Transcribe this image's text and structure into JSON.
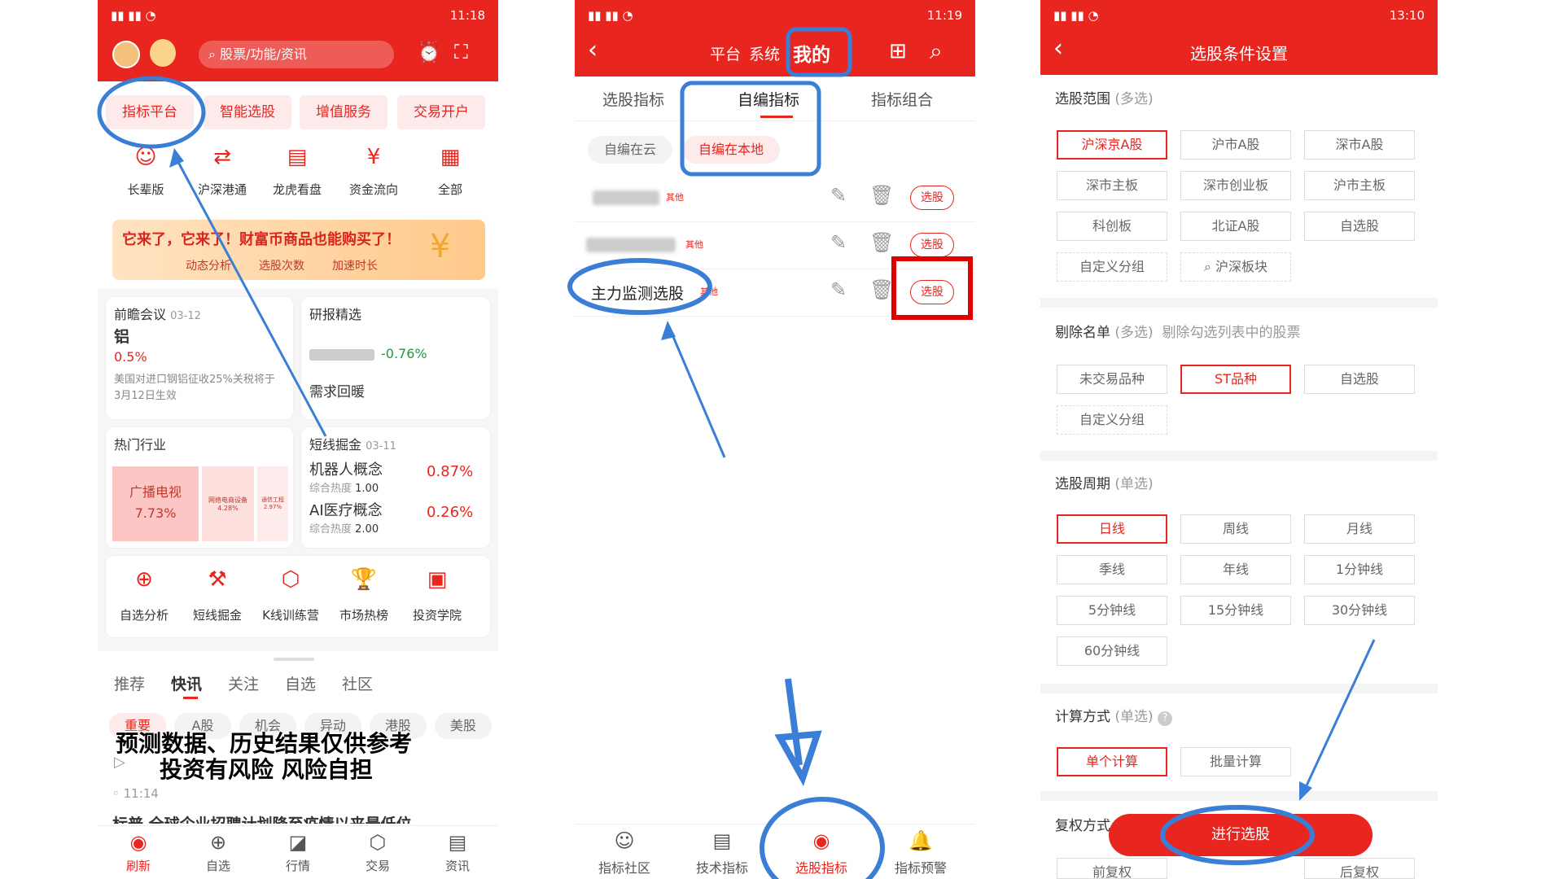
{
  "colors": {
    "brand_red": "#e8261f",
    "annotation_blue": "#3a7fd5",
    "highlight_red": "#e00000",
    "up": "#e8261f",
    "down": "#1a9c3c"
  },
  "p1": {
    "status_time": "11:18",
    "search_placeholder": "股票/功能/资讯",
    "tabs": [
      "指标平台",
      "智能选股",
      "增值服务",
      "交易开户"
    ],
    "icons": [
      {
        "label": "长辈版",
        "icon": "elder-icon"
      },
      {
        "label": "沪深港通",
        "icon": "exchange-icon"
      },
      {
        "label": "龙虎看盘",
        "icon": "board-icon"
      },
      {
        "label": "资金流向",
        "icon": "money-flow-icon"
      },
      {
        "label": "全部",
        "icon": "grid-icon"
      }
    ],
    "banner": {
      "title": "它来了，它来了！财富币商品也能购买了！",
      "sub1": "动态分析",
      "sub2": "选股次数",
      "sub3": "加速时长"
    },
    "card1": {
      "title": "前瞻会议",
      "date": "03-12",
      "item": "铝",
      "pct": "0.5%",
      "desc": "美国对进口钢铝征收25%关税将于3月12日生效"
    },
    "card2": {
      "title": "研报精选",
      "pct": "-0.76%",
      "item": "需求回暖"
    },
    "card3": {
      "title": "热门行业",
      "big": "广播电视",
      "big_pct": "7.73%",
      "mid": "网络电商设备",
      "mid_pct": "4.28%",
      "small": "通信工程",
      "small_pct": "2.97%"
    },
    "card4": {
      "title": "短线掘金",
      "date": "03-11",
      "r1": "机器人概念",
      "r1_sub": "综合热度",
      "r1_heat": "1.00",
      "r1_pct": "0.87%",
      "r2": "AI医疗概念",
      "r2_sub": "综合热度",
      "r2_heat": "2.00",
      "r2_pct": "0.26%"
    },
    "tools": [
      {
        "label": "自选分析",
        "icon": "add-analysis-icon"
      },
      {
        "label": "短线掘金",
        "icon": "gold-icon"
      },
      {
        "label": "K线训练营",
        "icon": "kline-icon"
      },
      {
        "label": "市场热榜",
        "icon": "trophy-icon"
      },
      {
        "label": "投资学院",
        "icon": "book-icon"
      }
    ],
    "feed_tabs": [
      "推荐",
      "快讯",
      "关注",
      "自选",
      "社区"
    ],
    "filters": [
      "重要",
      "A股",
      "机会",
      "异动",
      "港股",
      "美股"
    ],
    "news_time": "11:14",
    "news_text": "标普 全球企业招聘计划降至疫情以来最低位",
    "nav": [
      {
        "label": "刷新",
        "icon": "refresh-icon"
      },
      {
        "label": "自选",
        "icon": "plus-circle-icon"
      },
      {
        "label": "行情",
        "icon": "chart-icon"
      },
      {
        "label": "交易",
        "icon": "trade-icon"
      },
      {
        "label": "资讯",
        "icon": "news-icon"
      }
    ]
  },
  "p2": {
    "status_time": "11:19",
    "header_tabs": [
      "平台",
      "系统",
      "我的"
    ],
    "tabs": [
      "选股指标",
      "自编指标",
      "指标组合"
    ],
    "subtabs": [
      "自编在云",
      "自编在本地"
    ],
    "rows": [
      {
        "name": "",
        "tag": "其他",
        "action": "选股"
      },
      {
        "name": "",
        "tag": "其他",
        "action": "选股"
      },
      {
        "name": "主力监测选股",
        "tag": "其他",
        "action": "选股"
      }
    ],
    "nav": [
      {
        "label": "指标社区",
        "icon": "smile-icon"
      },
      {
        "label": "技术指标",
        "icon": "doc-icon"
      },
      {
        "label": "选股指标",
        "icon": "pick-icon"
      },
      {
        "label": "指标预警",
        "icon": "bell-icon"
      }
    ]
  },
  "p3": {
    "status_time": "13:10",
    "title": "选股条件设置",
    "range": {
      "label": "选股范围",
      "hint": "(多选)",
      "items": [
        "沪深京A股",
        "沪市A股",
        "深市A股",
        "深市主板",
        "深市创业板",
        "沪市主板",
        "科创板",
        "北证A股",
        "自选股",
        "自定义分组",
        "沪深板块"
      ]
    },
    "exclude": {
      "label": "剔除名单",
      "hint": "(多选)",
      "desc": "剔除勾选列表中的股票",
      "items": [
        "未交易品种",
        "ST品种",
        "自选股",
        "自定义分组"
      ]
    },
    "period": {
      "label": "选股周期",
      "hint": "(单选)",
      "items": [
        "日线",
        "周线",
        "月线",
        "季线",
        "年线",
        "1分钟线",
        "5分钟线",
        "15分钟线",
        "30分钟线",
        "60分钟线"
      ]
    },
    "calc": {
      "label": "计算方式",
      "hint": "(单选)",
      "items": [
        "单个计算",
        "批量计算"
      ]
    },
    "fq": {
      "label": "复权方式",
      "items": [
        "前复权",
        "后复权"
      ]
    },
    "go": "进行选股"
  },
  "overlay": {
    "line1": "预测数据、历史结果仅供参考",
    "line2": "投资有风险 风险自担"
  }
}
